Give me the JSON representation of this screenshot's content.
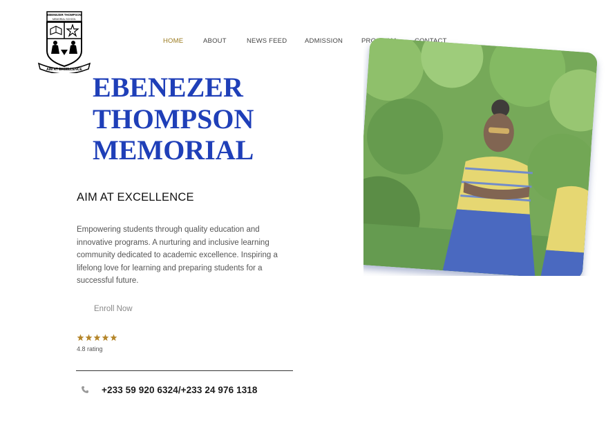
{
  "logo": {
    "school_name": "EBENEZER THOMPSON",
    "subtitle": "MEMORIAL SCHOOL",
    "motto": "AIM AT EXCELLENCE"
  },
  "nav": {
    "items": [
      {
        "label": "HOME",
        "active": true
      },
      {
        "label": "ABOUT",
        "active": false
      },
      {
        "label": "NEWS FEED",
        "active": false
      },
      {
        "label": "ADMISSION",
        "active": false
      },
      {
        "label": "PROGRAM",
        "active": false
      },
      {
        "label": "CONTACT",
        "active": false
      }
    ],
    "active_color": "#9a7a1e"
  },
  "hero": {
    "title_lines": [
      "EBENEZER",
      "THOMPSON",
      "MEMORIAL"
    ],
    "tagline": "AIM AT EXCELLENCE",
    "description": "Empowering students through quality education and innovative programs. A nurturing and inclusive learning community dedicated to academic excellence. Inspiring a lifelong love for learning and preparing students for a successful future.",
    "enroll_label": "Enroll Now",
    "rating_stars": 5,
    "rating_text": "4.8 rating",
    "star_color": "#b5862a",
    "phone_icon": "phone-icon",
    "phone": "+233 59 920 6324/+233 24 976 1318"
  },
  "colors": {
    "title": "#1f3fb8"
  }
}
